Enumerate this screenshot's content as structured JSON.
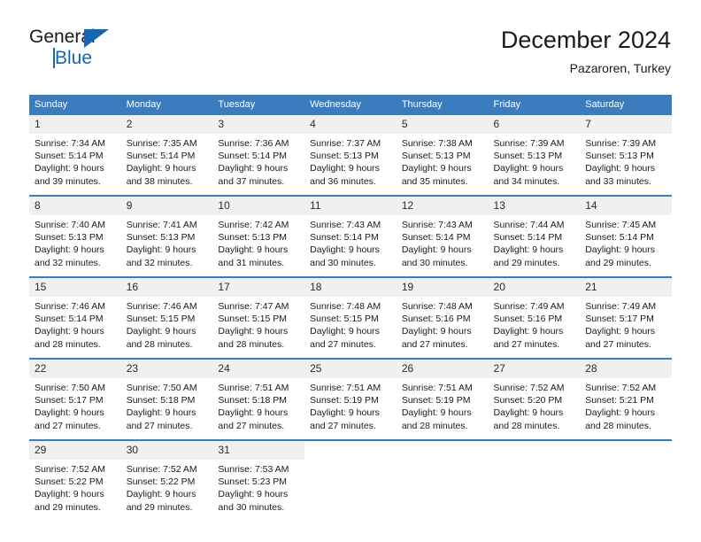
{
  "logo": {
    "word_top": "General",
    "word_bottom": "Blue",
    "triangle_color": "#1268b3",
    "text_color": "#1a1a1a"
  },
  "header": {
    "title": "December 2024",
    "subtitle": "Pazaroren, Turkey"
  },
  "theme": {
    "header_bg": "#3a7cbe",
    "header_text": "#ffffff",
    "daynum_bg": "#f0f0f0",
    "row_divider": "#3a7cbe"
  },
  "columns": [
    "Sunday",
    "Monday",
    "Tuesday",
    "Wednesday",
    "Thursday",
    "Friday",
    "Saturday"
  ],
  "weeks": [
    [
      {
        "day": "1",
        "sunrise": "Sunrise: 7:34 AM",
        "sunset": "Sunset: 5:14 PM",
        "daylight1": "Daylight: 9 hours",
        "daylight2": "and 39 minutes."
      },
      {
        "day": "2",
        "sunrise": "Sunrise: 7:35 AM",
        "sunset": "Sunset: 5:14 PM",
        "daylight1": "Daylight: 9 hours",
        "daylight2": "and 38 minutes."
      },
      {
        "day": "3",
        "sunrise": "Sunrise: 7:36 AM",
        "sunset": "Sunset: 5:14 PM",
        "daylight1": "Daylight: 9 hours",
        "daylight2": "and 37 minutes."
      },
      {
        "day": "4",
        "sunrise": "Sunrise: 7:37 AM",
        "sunset": "Sunset: 5:13 PM",
        "daylight1": "Daylight: 9 hours",
        "daylight2": "and 36 minutes."
      },
      {
        "day": "5",
        "sunrise": "Sunrise: 7:38 AM",
        "sunset": "Sunset: 5:13 PM",
        "daylight1": "Daylight: 9 hours",
        "daylight2": "and 35 minutes."
      },
      {
        "day": "6",
        "sunrise": "Sunrise: 7:39 AM",
        "sunset": "Sunset: 5:13 PM",
        "daylight1": "Daylight: 9 hours",
        "daylight2": "and 34 minutes."
      },
      {
        "day": "7",
        "sunrise": "Sunrise: 7:39 AM",
        "sunset": "Sunset: 5:13 PM",
        "daylight1": "Daylight: 9 hours",
        "daylight2": "and 33 minutes."
      }
    ],
    [
      {
        "day": "8",
        "sunrise": "Sunrise: 7:40 AM",
        "sunset": "Sunset: 5:13 PM",
        "daylight1": "Daylight: 9 hours",
        "daylight2": "and 32 minutes."
      },
      {
        "day": "9",
        "sunrise": "Sunrise: 7:41 AM",
        "sunset": "Sunset: 5:13 PM",
        "daylight1": "Daylight: 9 hours",
        "daylight2": "and 32 minutes."
      },
      {
        "day": "10",
        "sunrise": "Sunrise: 7:42 AM",
        "sunset": "Sunset: 5:13 PM",
        "daylight1": "Daylight: 9 hours",
        "daylight2": "and 31 minutes."
      },
      {
        "day": "11",
        "sunrise": "Sunrise: 7:43 AM",
        "sunset": "Sunset: 5:14 PM",
        "daylight1": "Daylight: 9 hours",
        "daylight2": "and 30 minutes."
      },
      {
        "day": "12",
        "sunrise": "Sunrise: 7:43 AM",
        "sunset": "Sunset: 5:14 PM",
        "daylight1": "Daylight: 9 hours",
        "daylight2": "and 30 minutes."
      },
      {
        "day": "13",
        "sunrise": "Sunrise: 7:44 AM",
        "sunset": "Sunset: 5:14 PM",
        "daylight1": "Daylight: 9 hours",
        "daylight2": "and 29 minutes."
      },
      {
        "day": "14",
        "sunrise": "Sunrise: 7:45 AM",
        "sunset": "Sunset: 5:14 PM",
        "daylight1": "Daylight: 9 hours",
        "daylight2": "and 29 minutes."
      }
    ],
    [
      {
        "day": "15",
        "sunrise": "Sunrise: 7:46 AM",
        "sunset": "Sunset: 5:14 PM",
        "daylight1": "Daylight: 9 hours",
        "daylight2": "and 28 minutes."
      },
      {
        "day": "16",
        "sunrise": "Sunrise: 7:46 AM",
        "sunset": "Sunset: 5:15 PM",
        "daylight1": "Daylight: 9 hours",
        "daylight2": "and 28 minutes."
      },
      {
        "day": "17",
        "sunrise": "Sunrise: 7:47 AM",
        "sunset": "Sunset: 5:15 PM",
        "daylight1": "Daylight: 9 hours",
        "daylight2": "and 28 minutes."
      },
      {
        "day": "18",
        "sunrise": "Sunrise: 7:48 AM",
        "sunset": "Sunset: 5:15 PM",
        "daylight1": "Daylight: 9 hours",
        "daylight2": "and 27 minutes."
      },
      {
        "day": "19",
        "sunrise": "Sunrise: 7:48 AM",
        "sunset": "Sunset: 5:16 PM",
        "daylight1": "Daylight: 9 hours",
        "daylight2": "and 27 minutes."
      },
      {
        "day": "20",
        "sunrise": "Sunrise: 7:49 AM",
        "sunset": "Sunset: 5:16 PM",
        "daylight1": "Daylight: 9 hours",
        "daylight2": "and 27 minutes."
      },
      {
        "day": "21",
        "sunrise": "Sunrise: 7:49 AM",
        "sunset": "Sunset: 5:17 PM",
        "daylight1": "Daylight: 9 hours",
        "daylight2": "and 27 minutes."
      }
    ],
    [
      {
        "day": "22",
        "sunrise": "Sunrise: 7:50 AM",
        "sunset": "Sunset: 5:17 PM",
        "daylight1": "Daylight: 9 hours",
        "daylight2": "and 27 minutes."
      },
      {
        "day": "23",
        "sunrise": "Sunrise: 7:50 AM",
        "sunset": "Sunset: 5:18 PM",
        "daylight1": "Daylight: 9 hours",
        "daylight2": "and 27 minutes."
      },
      {
        "day": "24",
        "sunrise": "Sunrise: 7:51 AM",
        "sunset": "Sunset: 5:18 PM",
        "daylight1": "Daylight: 9 hours",
        "daylight2": "and 27 minutes."
      },
      {
        "day": "25",
        "sunrise": "Sunrise: 7:51 AM",
        "sunset": "Sunset: 5:19 PM",
        "daylight1": "Daylight: 9 hours",
        "daylight2": "and 27 minutes."
      },
      {
        "day": "26",
        "sunrise": "Sunrise: 7:51 AM",
        "sunset": "Sunset: 5:19 PM",
        "daylight1": "Daylight: 9 hours",
        "daylight2": "and 28 minutes."
      },
      {
        "day": "27",
        "sunrise": "Sunrise: 7:52 AM",
        "sunset": "Sunset: 5:20 PM",
        "daylight1": "Daylight: 9 hours",
        "daylight2": "and 28 minutes."
      },
      {
        "day": "28",
        "sunrise": "Sunrise: 7:52 AM",
        "sunset": "Sunset: 5:21 PM",
        "daylight1": "Daylight: 9 hours",
        "daylight2": "and 28 minutes."
      }
    ],
    [
      {
        "day": "29",
        "sunrise": "Sunrise: 7:52 AM",
        "sunset": "Sunset: 5:22 PM",
        "daylight1": "Daylight: 9 hours",
        "daylight2": "and 29 minutes."
      },
      {
        "day": "30",
        "sunrise": "Sunrise: 7:52 AM",
        "sunset": "Sunset: 5:22 PM",
        "daylight1": "Daylight: 9 hours",
        "daylight2": "and 29 minutes."
      },
      {
        "day": "31",
        "sunrise": "Sunrise: 7:53 AM",
        "sunset": "Sunset: 5:23 PM",
        "daylight1": "Daylight: 9 hours",
        "daylight2": "and 30 minutes."
      },
      {
        "day": "",
        "sunrise": "",
        "sunset": "",
        "daylight1": "",
        "daylight2": ""
      },
      {
        "day": "",
        "sunrise": "",
        "sunset": "",
        "daylight1": "",
        "daylight2": ""
      },
      {
        "day": "",
        "sunrise": "",
        "sunset": "",
        "daylight1": "",
        "daylight2": ""
      },
      {
        "day": "",
        "sunrise": "",
        "sunset": "",
        "daylight1": "",
        "daylight2": ""
      }
    ]
  ]
}
